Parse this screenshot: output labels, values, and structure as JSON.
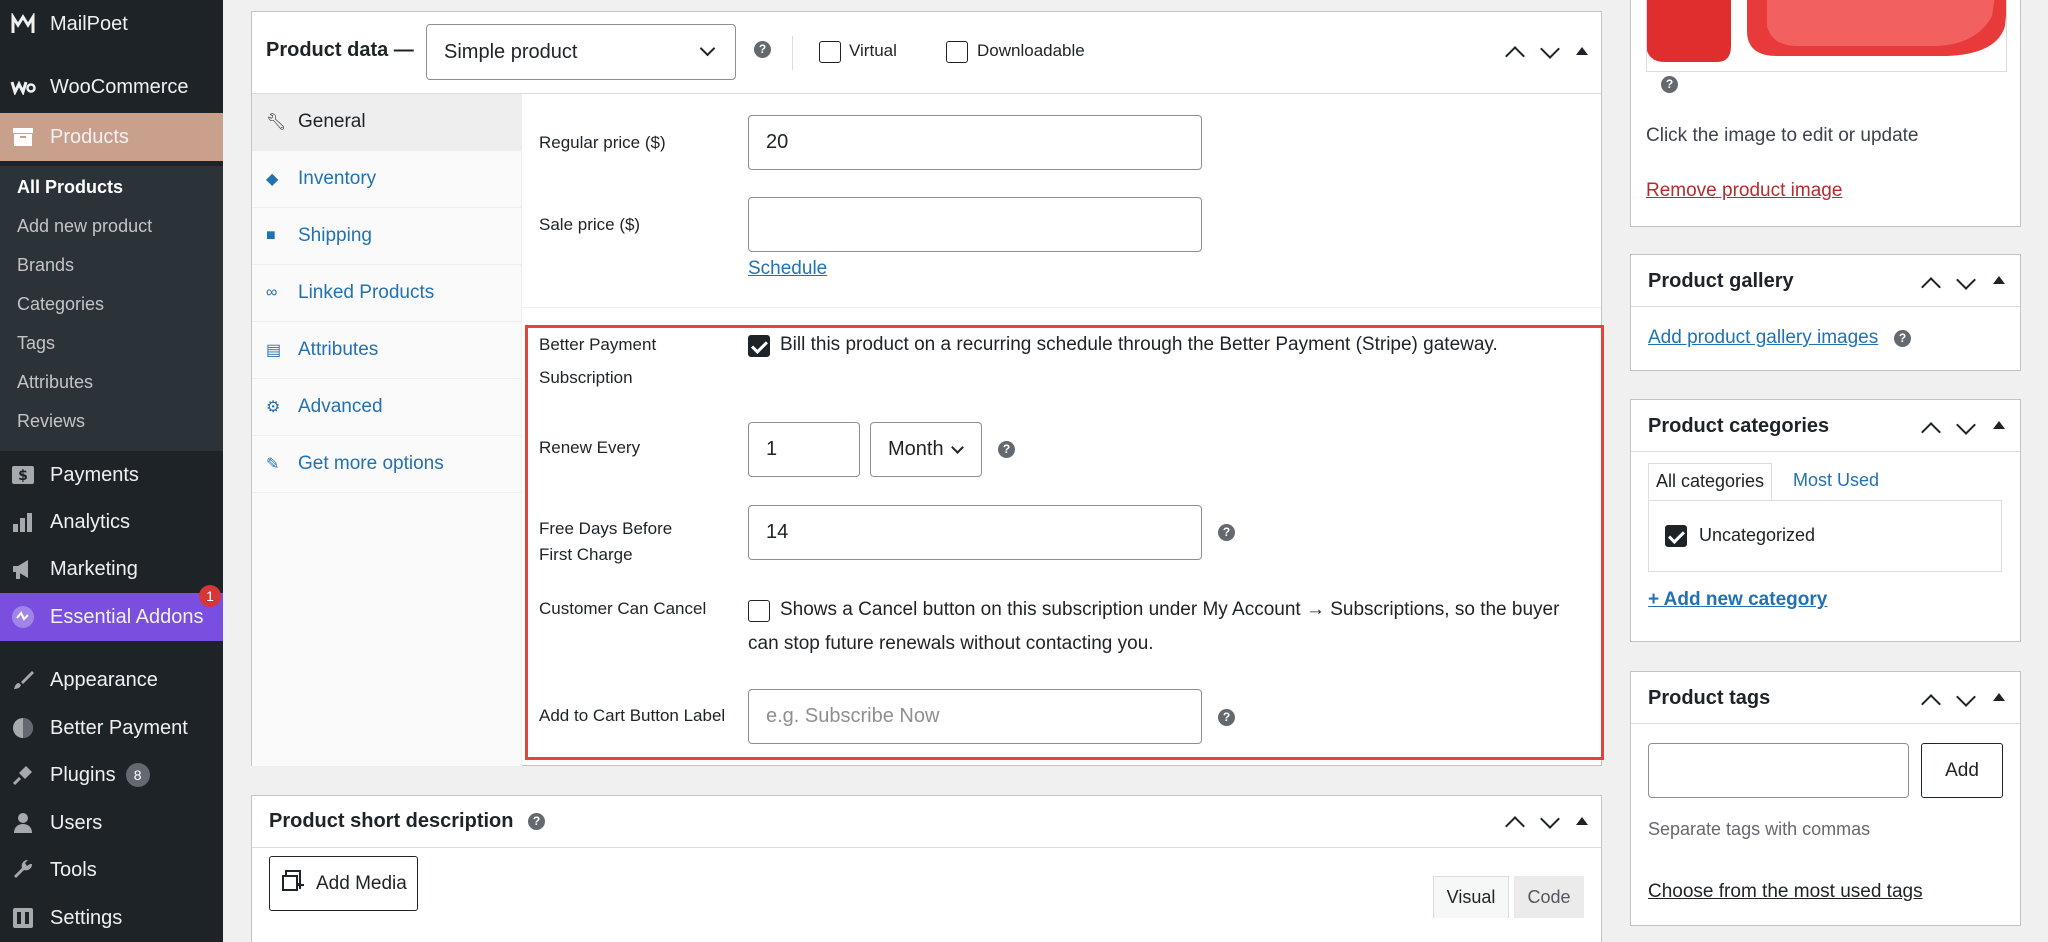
{
  "sidebar": {
    "items": [
      {
        "label": "MailPoet",
        "icon": "mailpoet-icon"
      },
      {
        "label": "WooCommerce",
        "icon": "woocommerce-icon"
      },
      {
        "label": "Products",
        "icon": "archive-icon"
      },
      {
        "label": "Payments",
        "icon": "dollar-icon"
      },
      {
        "label": "Analytics",
        "icon": "bar-chart-icon"
      },
      {
        "label": "Marketing",
        "icon": "megaphone-icon"
      },
      {
        "label": "Essential Addons",
        "icon": "ea-icon",
        "badge": "1"
      },
      {
        "label": "Appearance",
        "icon": "brush-icon"
      },
      {
        "label": "Better Payment",
        "icon": "better-payment-icon"
      },
      {
        "label": "Plugins",
        "icon": "plug-icon",
        "badge": "8"
      },
      {
        "label": "Users",
        "icon": "users-icon"
      },
      {
        "label": "Tools",
        "icon": "wrench-icon"
      },
      {
        "label": "Settings",
        "icon": "settings-icon"
      }
    ],
    "submenu": [
      "All Products",
      "Add new product",
      "Brands",
      "Categories",
      "Tags",
      "Attributes",
      "Reviews"
    ]
  },
  "product_data": {
    "title": "Product data —",
    "type_select": "Simple product",
    "virtual_label": "Virtual",
    "downloadable_label": "Downloadable",
    "tabs": [
      "General",
      "Inventory",
      "Shipping",
      "Linked Products",
      "Attributes",
      "Advanced",
      "Get more options"
    ],
    "regular_price_label": "Regular price ($)",
    "regular_price_value": "20",
    "sale_price_label": "Sale price ($)",
    "sale_price_value": "",
    "schedule_link": "Schedule",
    "subscription": {
      "label_line1": "Better Payment",
      "label_line2": "Subscription",
      "checkbox_text": "Bill this product on a recurring schedule through the Better Payment (Stripe) gateway.",
      "renew_label": "Renew Every",
      "renew_value": "1",
      "renew_unit": "Month",
      "free_days_label_line1": "Free Days Before",
      "free_days_label_line2": "First Charge",
      "free_days_value": "14",
      "cancel_label": "Customer Can Cancel",
      "cancel_text_line1": "Shows a Cancel button on this subscription under My Account → Subscriptions, so the buyer",
      "cancel_text_line2": "can stop future renewals without contacting you.",
      "cart_label": "Add to Cart Button Label",
      "cart_placeholder": "e.g. Subscribe Now"
    }
  },
  "short_description": {
    "title": "Product short description",
    "add_media": "Add Media",
    "visual_tab": "Visual",
    "code_tab": "Code"
  },
  "right": {
    "image_hint": "Click the image to edit or update",
    "remove_image": "Remove product image",
    "gallery_title": "Product gallery",
    "gallery_link": "Add product gallery images",
    "categories_title": "Product categories",
    "cat_tab_all": "All categories",
    "cat_tab_most": "Most Used",
    "cat_item": "Uncategorized",
    "add_category": "+ Add new category",
    "tags_title": "Product tags",
    "tags_add": "Add",
    "tags_hint": "Separate tags with commas",
    "tags_choose": "Choose from the most used tags"
  },
  "colors": {
    "highlight": "#e0453a",
    "link": "#2271b1",
    "sidebar": "#1d2327",
    "current": "#c8a08c",
    "ea": "#7a4fe0"
  }
}
